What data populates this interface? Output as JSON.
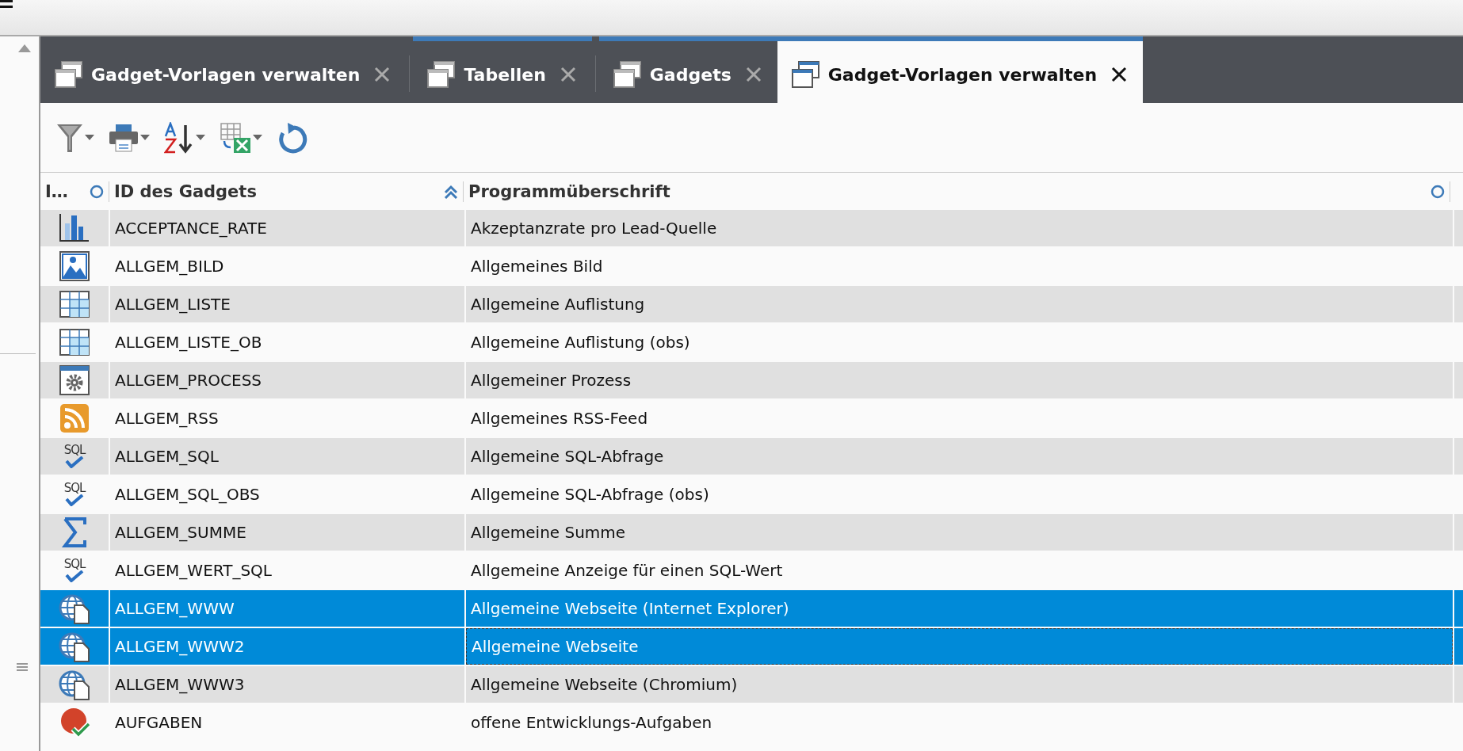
{
  "tabs": [
    {
      "label": "Gadget-Vorlagen verwalten",
      "selected": false,
      "accent": false
    },
    {
      "label": "Tabellen",
      "selected": false,
      "accent": true
    },
    {
      "label": "Gadgets",
      "selected": false,
      "accent": true
    },
    {
      "label": "Gadget-Vorlagen verwalten",
      "selected": true,
      "accent": true
    }
  ],
  "table": {
    "columns": [
      {
        "label": "I…",
        "sorted": false
      },
      {
        "label": "ID des Gadgets",
        "sorted": true
      },
      {
        "label": "Programmüberschrift",
        "sorted": false
      }
    ],
    "rows": [
      {
        "kind": "chart",
        "id": "ACCEPTANCE_RATE",
        "title": "Akzeptanzrate pro Lead-Quelle",
        "selected": false,
        "focused": false
      },
      {
        "kind": "image",
        "id": "ALLGEM_BILD",
        "title": "Allgemeines Bild",
        "selected": false,
        "focused": false
      },
      {
        "kind": "table",
        "id": "ALLGEM_LISTE",
        "title": "Allgemeine Auflistung",
        "selected": false,
        "focused": false
      },
      {
        "kind": "table",
        "id": "ALLGEM_LISTE_OB",
        "title": "Allgemeine Auflistung (obs)",
        "selected": false,
        "focused": false
      },
      {
        "kind": "gear",
        "id": "ALLGEM_PROCESS",
        "title": "Allgemeiner Prozess",
        "selected": false,
        "focused": false
      },
      {
        "kind": "rss",
        "id": "ALLGEM_RSS",
        "title": "Allgemeines RSS-Feed",
        "selected": false,
        "focused": false
      },
      {
        "kind": "sql",
        "icon_label": "SQL",
        "id": "ALLGEM_SQL",
        "title": "Allgemeine SQL-Abfrage",
        "selected": false,
        "focused": false
      },
      {
        "kind": "sql",
        "icon_label": "SQL",
        "id": "ALLGEM_SQL_OBS",
        "title": "Allgemeine SQL-Abfrage (obs)",
        "selected": false,
        "focused": false
      },
      {
        "kind": "sigma",
        "id": "ALLGEM_SUMME",
        "title": "Allgemeine Summe",
        "selected": false,
        "focused": false
      },
      {
        "kind": "sql",
        "icon_label": "SQL",
        "id": "ALLGEM_WERT_SQL",
        "title": "Allgemeine Anzeige für einen SQL-Wert",
        "selected": false,
        "focused": false
      },
      {
        "kind": "web",
        "id": "ALLGEM_WWW",
        "title": "Allgemeine Webseite (Internet Explorer)",
        "selected": true,
        "focused": false
      },
      {
        "kind": "web",
        "id": "ALLGEM_WWW2",
        "title": "Allgemeine Webseite",
        "selected": true,
        "focused": true
      },
      {
        "kind": "web",
        "id": "ALLGEM_WWW3",
        "title": "Allgemeine Webseite (Chromium)",
        "selected": false,
        "focused": false
      },
      {
        "kind": "task",
        "id": "AUFGABEN",
        "title": "offene Entwicklungs-Aufgaben",
        "selected": false,
        "focused": false
      }
    ]
  }
}
